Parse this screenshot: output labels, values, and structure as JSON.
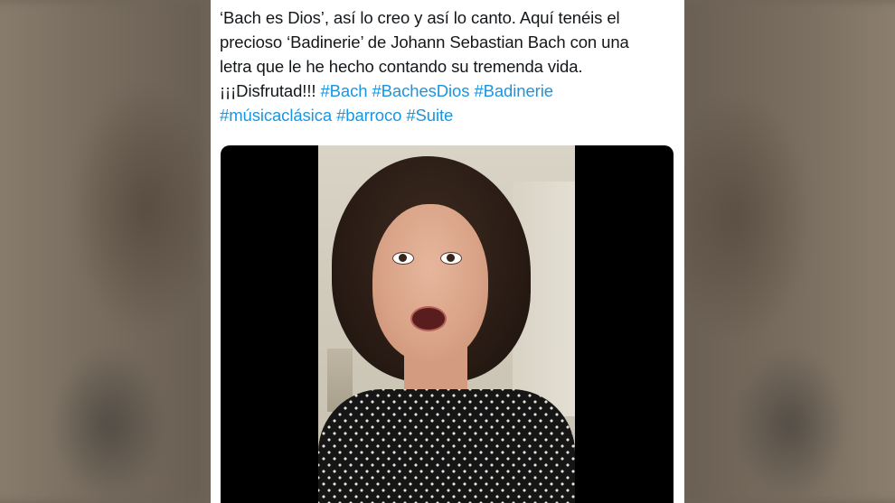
{
  "tweet": {
    "text_lines": [
      "‘Bach es Dios’, así lo creo y así lo canto. Aquí tenéis el",
      "precioso ‘Badinerie’ de Johann Sebastian Bach con una",
      "letra que le he hecho contando su tremenda vida."
    ],
    "text_line4_prefix": "¡¡¡Disfrutad!!! ",
    "hashtags_line4": [
      "#Bach",
      "#BachesDios",
      "#Badinerie"
    ],
    "hashtags_line5": [
      "#músicaclásica",
      "#barroco",
      "#Suite"
    ]
  },
  "colors": {
    "hashtag": "#1b95e0",
    "text": "#14171a",
    "video_background": "#000000"
  }
}
